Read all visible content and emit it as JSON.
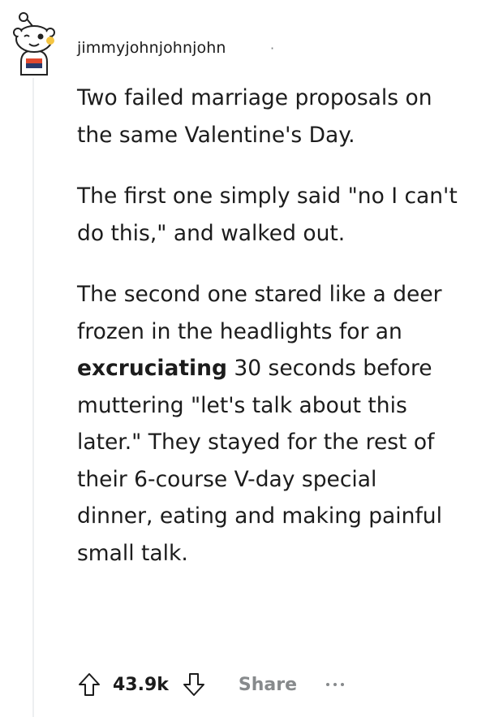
{
  "comment": {
    "username": "jimmyjohnjohnjohn",
    "separator": "·",
    "paragraphs": [
      {
        "text": "Two failed marriage proposals on the same Valentine's Day."
      },
      {
        "text": "The first one simply said \"no I can't do this,\" and walked out."
      },
      {
        "before": "The second one stared like a deer frozen in the headlights for an ",
        "bold": "excruciating",
        "after": " 30 seconds before muttering \"let's talk about this later.\" They stayed for the rest of their 6-course V-day special dinner, eating and making painful small talk."
      }
    ]
  },
  "actions": {
    "upvote_icon": "arrow-up-icon",
    "score": "43.9k",
    "downvote_icon": "arrow-down-icon",
    "share_label": "Share",
    "more_icon": "more-dots-icon"
  }
}
